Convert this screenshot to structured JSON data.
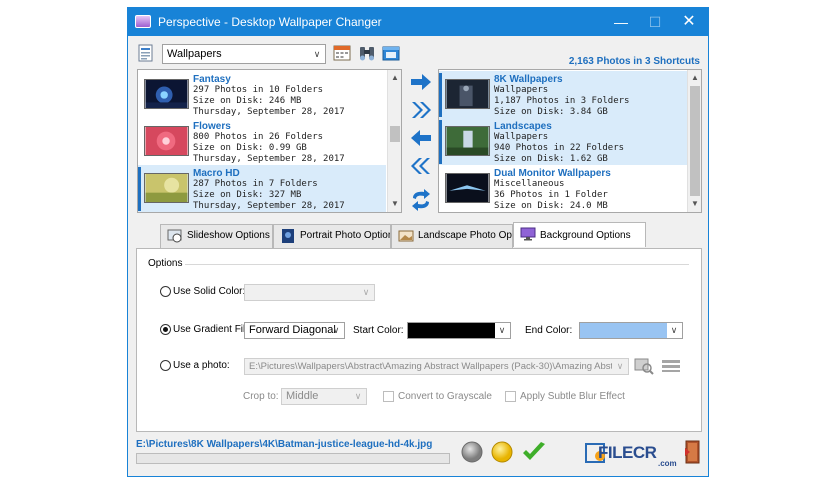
{
  "window": {
    "title": "Perspective - Desktop Wallpaper Changer",
    "minimize_glyph": "—",
    "maximize_glyph": "☐",
    "close_glyph": "✕"
  },
  "toolbar": {
    "shortcut_combo_value": "Wallpapers",
    "photo_count": "2,163 Photos in 3 Shortcuts",
    "icons": [
      "list-icon",
      "calendar-icon",
      "binoculars-icon",
      "folder-window-icon"
    ]
  },
  "left_list": {
    "items": [
      {
        "name": "Fantasy",
        "line1": "297 Photos in 10 Folders",
        "line2": "Size on Disk: 246 MB",
        "line3": "Thursday, September 28, 2017",
        "selected": false
      },
      {
        "name": "Flowers",
        "line1": "800 Photos in 26 Folders",
        "line2": "Size on Disk: 0.99 GB",
        "line3": "Thursday, September 28, 2017",
        "selected": false
      },
      {
        "name": "Macro HD",
        "line1": "287 Photos in 7 Folders",
        "line2": "Size on Disk: 327 MB",
        "line3": "Thursday, September 28, 2017",
        "selected": true
      }
    ],
    "scroll_up_glyph": "▲",
    "scroll_down_glyph": "▼"
  },
  "right_list": {
    "items": [
      {
        "name": "8K Wallpapers",
        "line1": "Wallpapers",
        "line2": "1,187 Photos in 3 Folders",
        "line3": "Size on Disk: 3.84 GB",
        "selected": true
      },
      {
        "name": "Landscapes",
        "line1": "Wallpapers",
        "line2": "940 Photos in 22 Folders",
        "line3": "Size on Disk: 1.62 GB",
        "selected": true
      },
      {
        "name": "Dual Monitor Wallpapers",
        "line1": "Miscellaneous",
        "line2": "36 Photos in 1 Folder",
        "line3": "Size on Disk: 24.0 MB",
        "selected": false
      }
    ],
    "scroll_up_glyph": "▲",
    "scroll_down_glyph": "▼"
  },
  "tabs": [
    {
      "label": "Slideshow Options",
      "icon": "slideshow-icon"
    },
    {
      "label": "Portrait Photo Options",
      "icon": "portrait-photo-icon"
    },
    {
      "label": "Landscape Photo Options",
      "icon": "landscape-photo-icon"
    },
    {
      "label": "Background Options",
      "icon": "monitor-icon",
      "active": true
    }
  ],
  "options": {
    "group_title": "Options",
    "solid_color_label": "Use Solid Color:",
    "gradient_label": "Use Gradient Fill:",
    "gradient_value": "Forward Diagonal",
    "start_color_label": "Start Color:",
    "start_color": "#000000",
    "end_color_label": "End Color:",
    "end_color": "#99c4f2",
    "photo_label": "Use a photo:",
    "photo_path": "E:\\Pictures\\Wallpapers\\Abstract\\Amazing Abstract Wallpapers (Pack-30)\\Amazing Abstract Wallp",
    "crop_label": "Crop to:",
    "crop_value": "Middle",
    "grayscale_label": "Convert to Grayscale",
    "blur_label": "Apply Subtle Blur Effect",
    "selected_option": "gradient"
  },
  "status": {
    "current_path": "E:\\Pictures\\8K Wallpapers\\4K\\Batman-justice-league-hd-4k.jpg",
    "progress_fraction": 0.0
  },
  "watermark": {
    "text": "FILECR",
    "sub": ".com"
  },
  "colors": {
    "title_bar": "#1883d7",
    "link_blue": "#1e6fbf",
    "arrow_blue": "#1e73c8"
  },
  "combo_arrow_glyph": "∨"
}
